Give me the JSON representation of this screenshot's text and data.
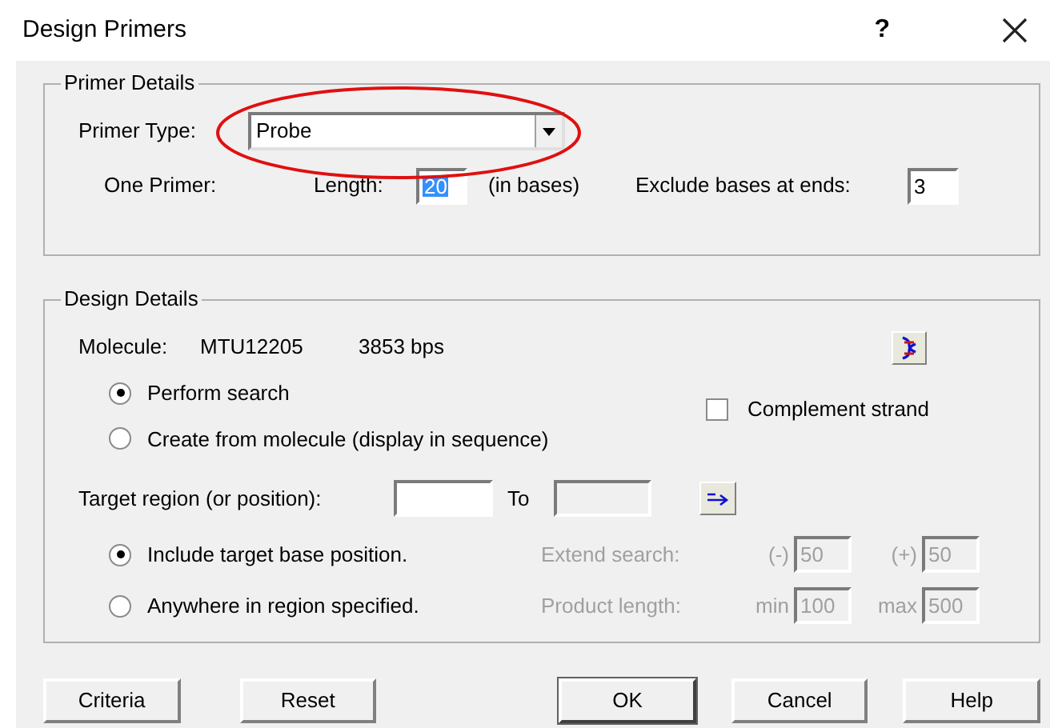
{
  "window": {
    "title": "Design Primers",
    "help_button": "?"
  },
  "primer_details": {
    "title": "Primer Details",
    "primer_type": {
      "label": "Primer Type:",
      "value": "Probe"
    },
    "one_primer_label": "One Primer:",
    "length": {
      "label": "Length:",
      "value": "20",
      "value_selected": true,
      "unit": "(in bases)"
    },
    "exclude": {
      "label": "Exclude bases at ends:",
      "value": "3"
    }
  },
  "design_details": {
    "title": "Design Details",
    "molecule": {
      "label": "Molecule:",
      "name": "MTU12205",
      "size": "3853 bps"
    },
    "mode_options": [
      {
        "label": "Perform search",
        "selected": true
      },
      {
        "label": "Create from molecule (display in sequence)",
        "selected": false
      }
    ],
    "complement_strand": {
      "label": "Complement strand",
      "checked": false
    },
    "target_region": {
      "label": "Target region (or position):",
      "to_label": "To",
      "to_disabled": true
    },
    "position_options": [
      {
        "label": "Include target base position.",
        "selected": true
      },
      {
        "label": "Anywhere in region specified.",
        "selected": false
      }
    ],
    "extend_search": {
      "label": "Extend search:",
      "disabled": true,
      "minus_label": "(-)",
      "minus_value": "50",
      "plus_label": "(+)",
      "plus_value": "50"
    },
    "product_length": {
      "label": "Product length:",
      "disabled": true,
      "min_label": "min",
      "min_value": "100",
      "max_label": "max",
      "max_value": "500"
    }
  },
  "buttons": [
    {
      "label": "Criteria",
      "default": false
    },
    {
      "label": "Reset",
      "default": false
    },
    {
      "label": "OK",
      "default": true
    },
    {
      "label": "Cancel",
      "default": false
    },
    {
      "label": "Help",
      "default": false
    }
  ]
}
